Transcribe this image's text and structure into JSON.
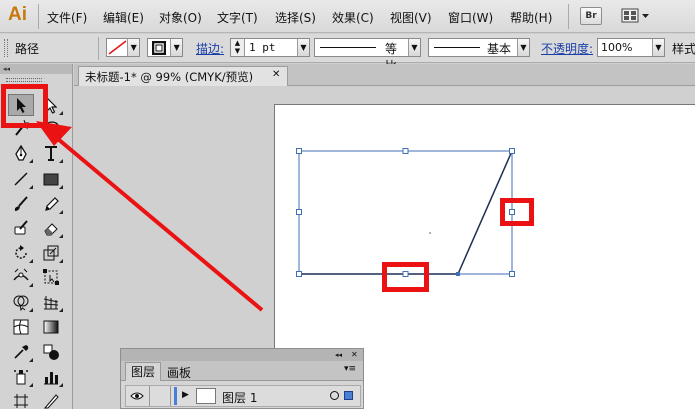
{
  "app": {
    "logo": "Ai"
  },
  "menu": {
    "items": [
      "文件(F)",
      "编辑(E)",
      "对象(O)",
      "文字(T)",
      "选择(S)",
      "效果(C)",
      "视图(V)",
      "窗口(W)",
      "帮助(H)"
    ],
    "bridge_label": "Br"
  },
  "control_bar": {
    "selection_label": "路径",
    "stroke_label": "描边:",
    "stroke_value": "1 pt",
    "profile_label": "等比",
    "brush_label": "基本",
    "opacity_label": "不透明度:",
    "opacity_value": "100%",
    "style_label": "样式"
  },
  "toolbar": {
    "collapse_glyph": "◂◂"
  },
  "document": {
    "tab_title": "未标题-1* @ 99% (CMYK/预览)",
    "close_glyph": "✕"
  },
  "layers_panel": {
    "collapse_glyph": "◂◂",
    "close_glyph": "✕",
    "tabs": [
      "图层",
      "画板"
    ],
    "layer_name": "图层 1"
  },
  "colors": {
    "highlight_red": "#ea1212",
    "path_blue": "#3f6fb5",
    "path_dark": "#1c2f55",
    "logo_orange": "#c8780f"
  }
}
